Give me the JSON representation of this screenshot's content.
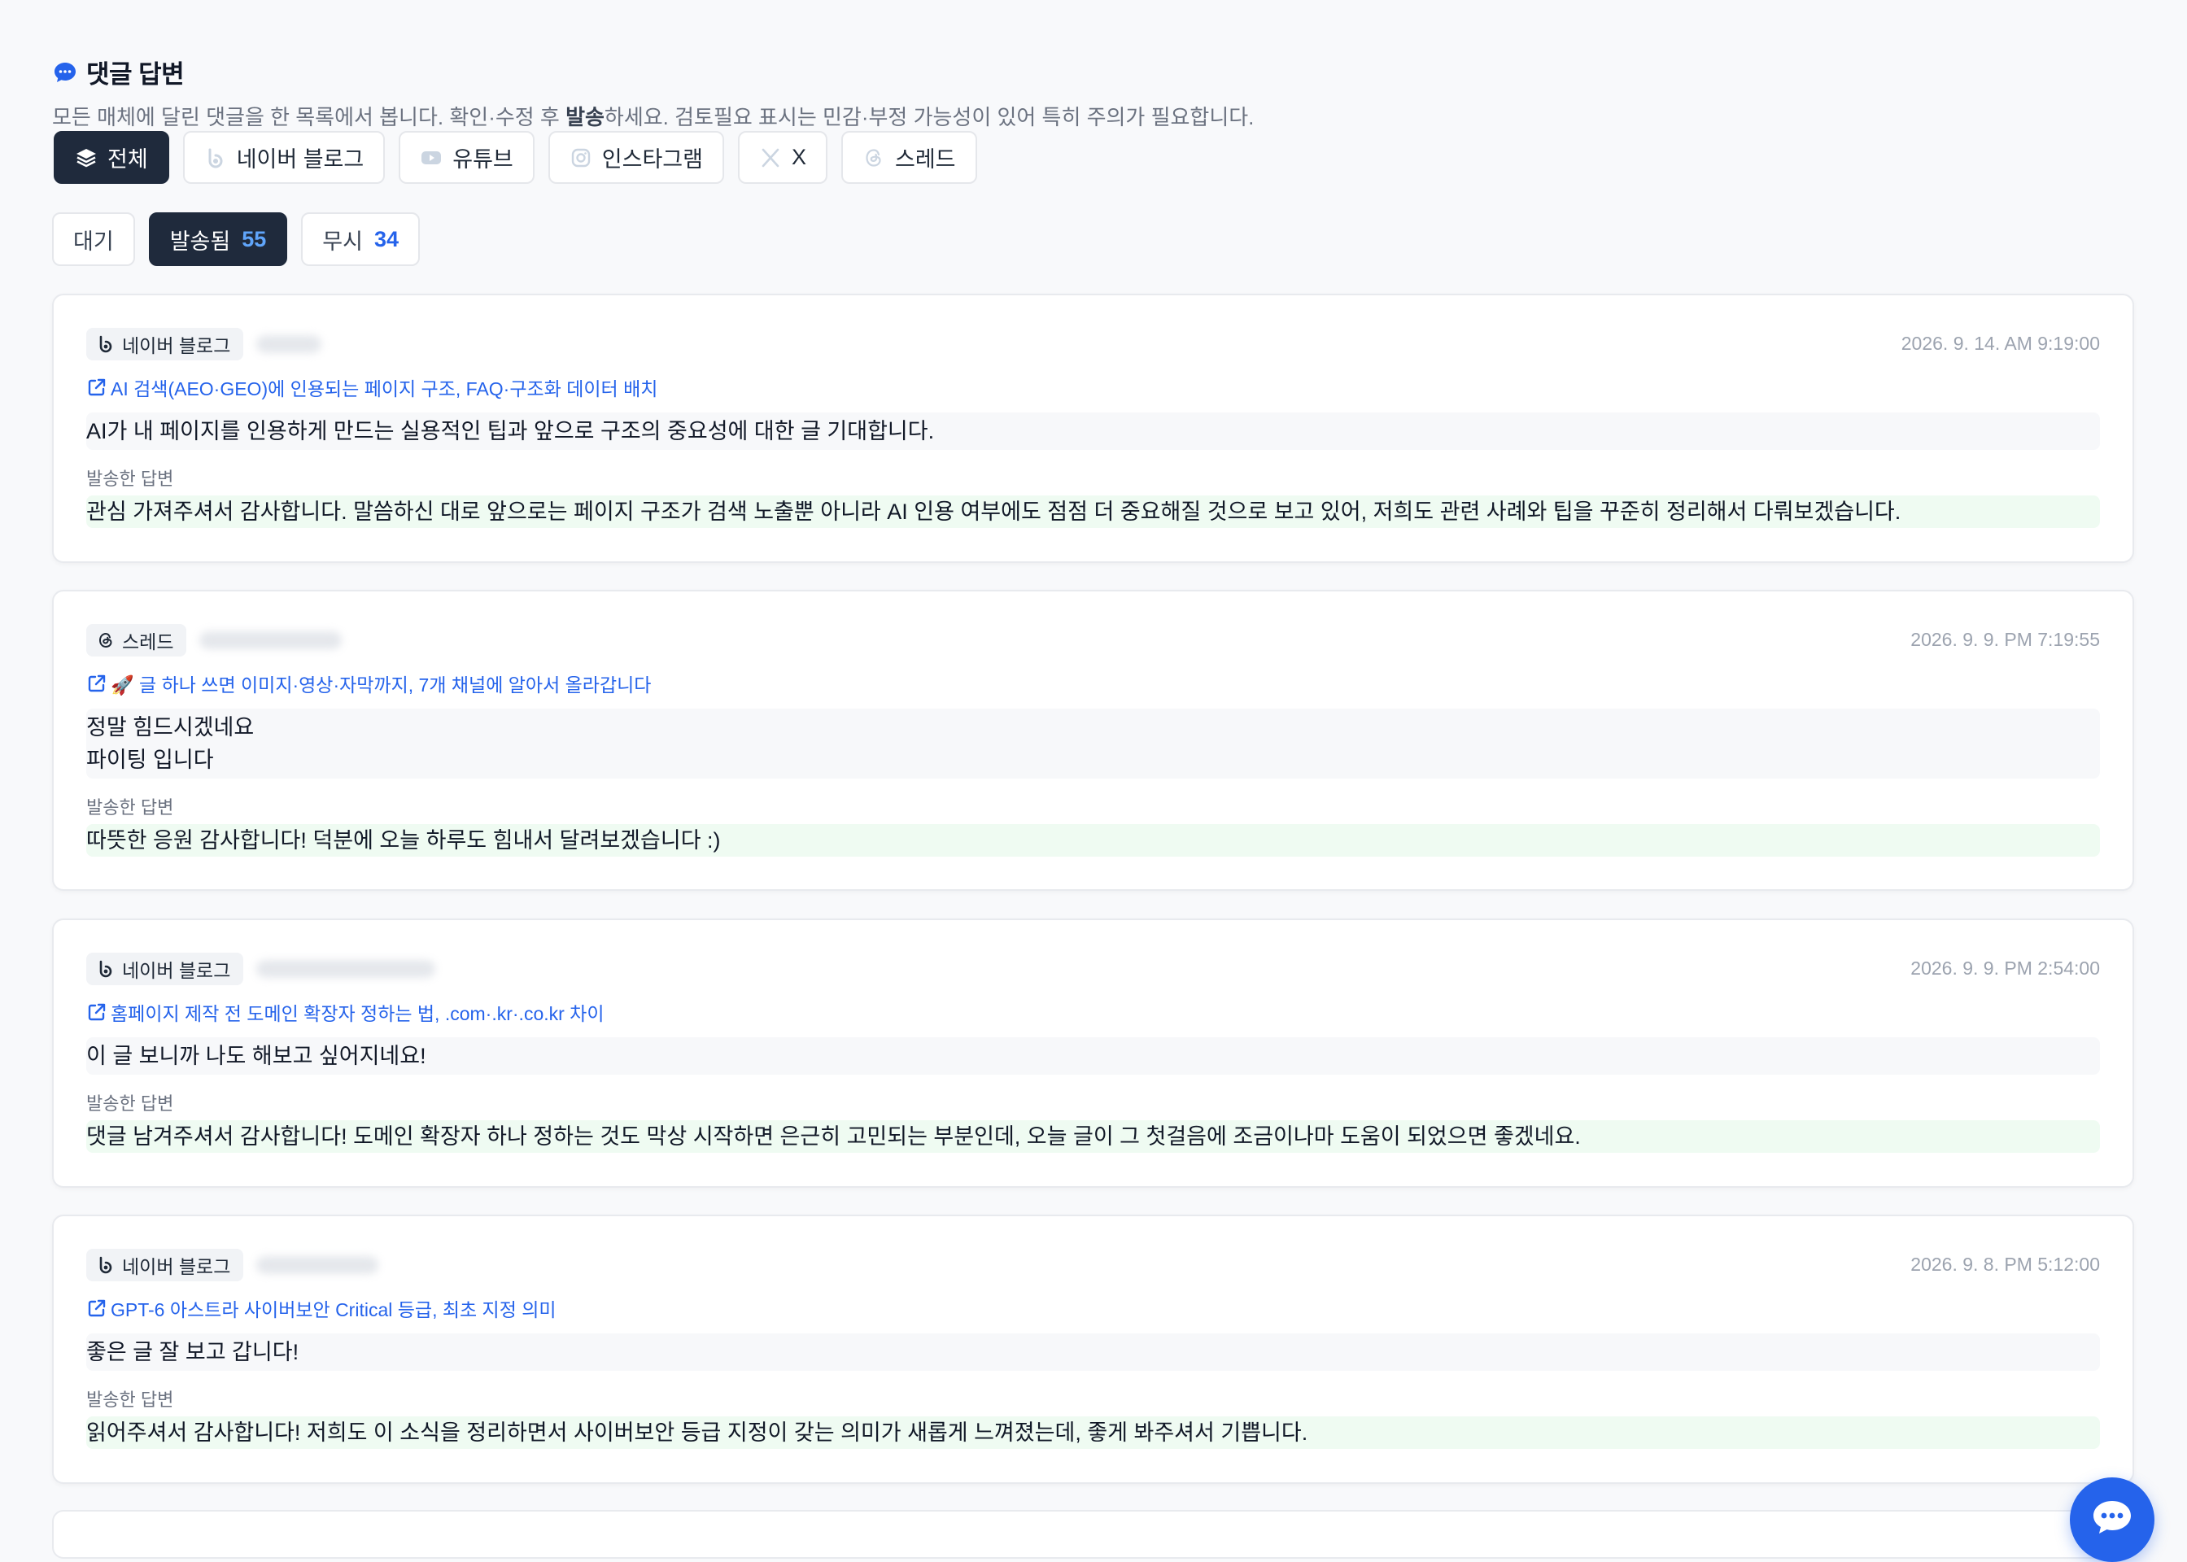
{
  "header": {
    "title": "댓글 답변",
    "desc_before": "모든 매체에 달린 댓글을 한 목록에서 봅니다. 확인·수정 후 ",
    "desc_bold": "발송",
    "desc_after": "하세요. 검토필요 표시는 민감·부정 가능성이 있어 특히 주의가 필요합니다."
  },
  "platform_filter": {
    "all": "전체",
    "naver": "네이버 블로그",
    "youtube": "유튜브",
    "instagram": "인스타그램",
    "x": "X",
    "threads": "스레드"
  },
  "status_tabs": {
    "pending": "대기",
    "sent": "발송됨",
    "sent_count": "55",
    "ignored": "무시",
    "ignored_count": "34"
  },
  "reply_label": "발송한 답변",
  "cards": [
    {
      "platform": "네이버 블로그",
      "timestamp": "2026. 9. 14. AM 9:19:00",
      "post_title": "AI 검색(AEO·GEO)에 인용되는 페이지 구조, FAQ·구조화 데이터 배치",
      "comment": "AI가 내 페이지를 인용하게 만드는 실용적인 팁과 앞으로 구조의 중요성에 대한 글 기대합니다.",
      "reply": "관심 가져주셔서 감사합니다. 말씀하신 대로 앞으로는 페이지 구조가 검색 노출뿐 아니라 AI 인용 여부에도 점점 더 중요해질 것으로 보고 있어, 저희도 관련 사례와 팁을 꾸준히 정리해서 다뤄보겠습니다."
    },
    {
      "platform": "스레드",
      "timestamp": "2026. 9. 9. PM 7:19:55",
      "post_title": "🚀 글 하나 쓰면 이미지·영상·자막까지, 7개 채널에 알아서 올라갑니다",
      "comment_line1": "정말 힘드시겠네요",
      "comment_line2": "파이팅 입니다",
      "reply": "따뜻한 응원 감사합니다! 덕분에 오늘 하루도 힘내서 달려보겠습니다 :)"
    },
    {
      "platform": "네이버 블로그",
      "timestamp": "2026. 9. 9. PM 2:54:00",
      "post_title": "홈페이지 제작 전 도메인 확장자 정하는 법, .com·.kr·.co.kr 차이",
      "comment": "이 글 보니까 나도 해보고 싶어지네요!",
      "reply": "댓글 남겨주셔서 감사합니다! 도메인 확장자 하나 정하는 것도 막상 시작하면 은근히 고민되는 부분인데, 오늘 글이 그 첫걸음에 조금이나마 도움이 되었으면 좋겠네요."
    },
    {
      "platform": "네이버 블로그",
      "timestamp": "2026. 9. 8. PM 5:12:00",
      "post_title": "GPT-6 아스트라 사이버보안 Critical 등급, 최초 지정 의미",
      "comment": "좋은 글 잘 보고 갑니다!",
      "reply": "읽어주셔서 감사합니다! 저희도 이 소식을 정리하면서 사이버보안 등급 지정이 갖는 의미가 새롭게 느껴졌는데, 좋게 봐주셔서 기쁩니다."
    }
  ],
  "colors": {
    "accent": "#2563eb",
    "dark": "#1f2a3c",
    "reply_bg": "#effbf2"
  }
}
